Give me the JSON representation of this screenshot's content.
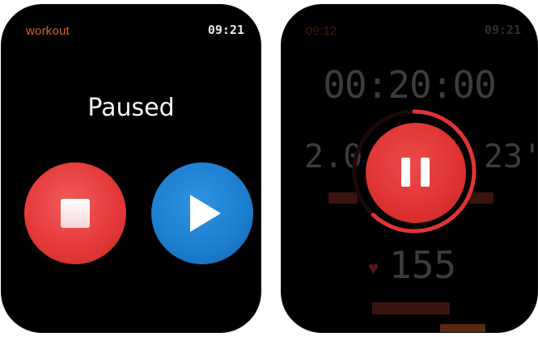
{
  "colors": {
    "accent_orange": "#d4622a",
    "status_time": "#e8e8e8",
    "end_red": "#e53a3a",
    "resume_blue": "#1d7fd0",
    "pause_red": "#e03434"
  },
  "paused_screen": {
    "app_title": "workout",
    "time": "09:21",
    "status_label": "Paused",
    "end_button_icon": "stop-icon",
    "resume_button_icon": "play-icon"
  },
  "active_screen": {
    "app_title": "09:12",
    "time": "09:21",
    "elapsed_time": "00:20:00",
    "distance_value": "2.0",
    "pace_value": "23'",
    "heart_rate": "155",
    "pause_button_icon": "pause-icon",
    "progress_ring_fraction": 0.62
  }
}
